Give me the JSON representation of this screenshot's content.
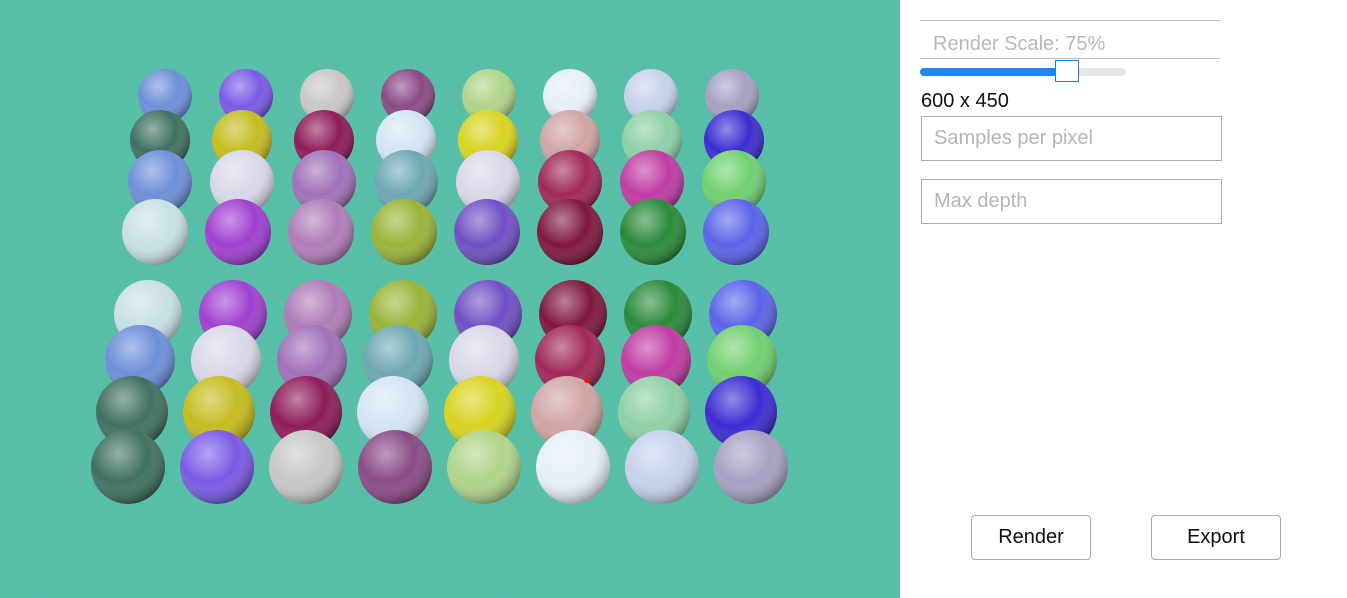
{
  "viewport": {
    "background": "#58c8ae",
    "sphere_colors": [
      [
        "#6d8fd8",
        "#7a5ae6",
        "#c8c8c8",
        "#8a4a86",
        "#b0d489",
        "#e6eef8",
        "#c6d2ec",
        "#a8a0c4"
      ],
      [
        "#3f7060",
        "#c4bc20",
        "#8e1c58",
        "#d4e4f4",
        "#d8d420",
        "#d0a4a4",
        "#8ed0a4",
        "#3c2cd2"
      ],
      [
        "#6d8fd8",
        "#d8d8e8",
        "#a070b8",
        "#6ea8b4",
        "#d8d8e8",
        "#a02858",
        "#c03ca4",
        "#70d070"
      ],
      [
        "#c8e0e4",
        "#a040d0",
        "#b07cb8",
        "#9ab438",
        "#7050c4",
        "#801840",
        "#2a8a3a",
        "#5a64e8"
      ],
      [
        "#c8e0e4",
        "#a040d0",
        "#b07cb8",
        "#9ab438",
        "#7050c4",
        "#801840",
        "#2a8a3a",
        "#5a64e8"
      ],
      [
        "#6d8fd8",
        "#d8d8e8",
        "#a070b8",
        "#6ea8b4",
        "#d8d8e8",
        "#a02858",
        "#c03ca4",
        "#70d070"
      ],
      [
        "#3f7060",
        "#c4bc20",
        "#8e1c58",
        "#d4e4f4",
        "#d8d420",
        "#d0a4a4",
        "#8ed0a4",
        "#3c2cd2"
      ],
      [
        "#3f7060",
        "#7a5ae6",
        "#c8c8c8",
        "#8a4a86",
        "#b0d489",
        "#e6eef8",
        "#c6d2ec",
        "#a8a0c4"
      ]
    ]
  },
  "controls": {
    "render_scale_label": "Render Scale: 75%",
    "render_scale_percent": 75,
    "resolution_text": "600 x 450",
    "samples_placeholder": "Samples per pixel",
    "max_depth_placeholder": "Max depth"
  },
  "buttons": {
    "render_label": "Render",
    "export_label": "Export"
  },
  "colors": {
    "accent": "#1e88f0",
    "border": "#adadad"
  }
}
